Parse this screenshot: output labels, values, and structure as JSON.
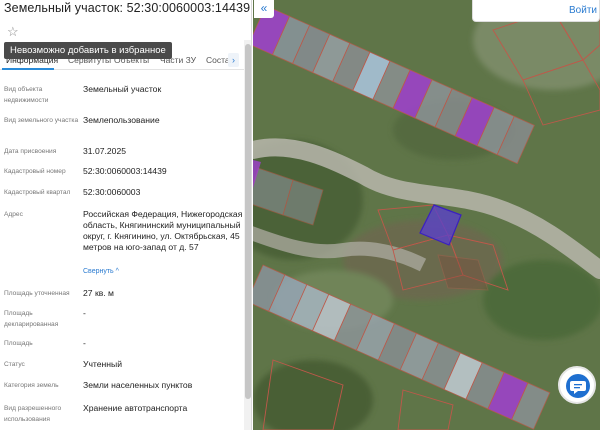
{
  "header": {
    "title": "Земельный участок: 52:30:0060003:14439",
    "favorite_tooltip": "Невозможно добавить в избранное",
    "collapse_icon": "«",
    "login_label": "Войти"
  },
  "tabs": [
    {
      "label": "Информация",
      "active": true
    },
    {
      "label": "Сервитуты",
      "active": false
    },
    {
      "label": "Объекты",
      "active": false
    },
    {
      "label": "Части ЗУ",
      "active": false
    },
    {
      "label": "Состав",
      "active": false
    }
  ],
  "tabs_scroll_icon": "›",
  "properties": [
    {
      "label": "Вид объекта недвижимости",
      "value": "Земельный участок"
    },
    {
      "label": "Вид земельного участка",
      "value": "Землепользование"
    },
    {
      "label": "Дата присвоения",
      "value": "31.07.2025"
    },
    {
      "label": "Кадастровый номер",
      "value": "52:30:0060003:14439"
    },
    {
      "label": "Кадастровый квартал",
      "value": "52:30:0060003"
    },
    {
      "label": "Адрес",
      "value": "Российская Федерация, Нижегородская область, Княгининский муниципальный округ, г. Княгинино, ул. Октябрьская, 45 метров на юго-запад от д. 57",
      "link": "Свернуть ^"
    },
    {
      "label": "Площадь уточненная",
      "value": "27 кв. м"
    },
    {
      "label": "Площадь декларированная",
      "value": "-"
    },
    {
      "label": "Площадь",
      "value": "-"
    },
    {
      "label": "Статус",
      "value": "Учтенный"
    },
    {
      "label": "Категория земель",
      "value": "Земли населенных пунктов"
    },
    {
      "label": "Вид разрешенного использования",
      "value": "Хранение автотранспорта"
    }
  ],
  "map": {
    "selected_parcel_color": "#5a3fd0",
    "highlight_color": "#b040d0",
    "parcel_border_color": "#c0584a"
  }
}
